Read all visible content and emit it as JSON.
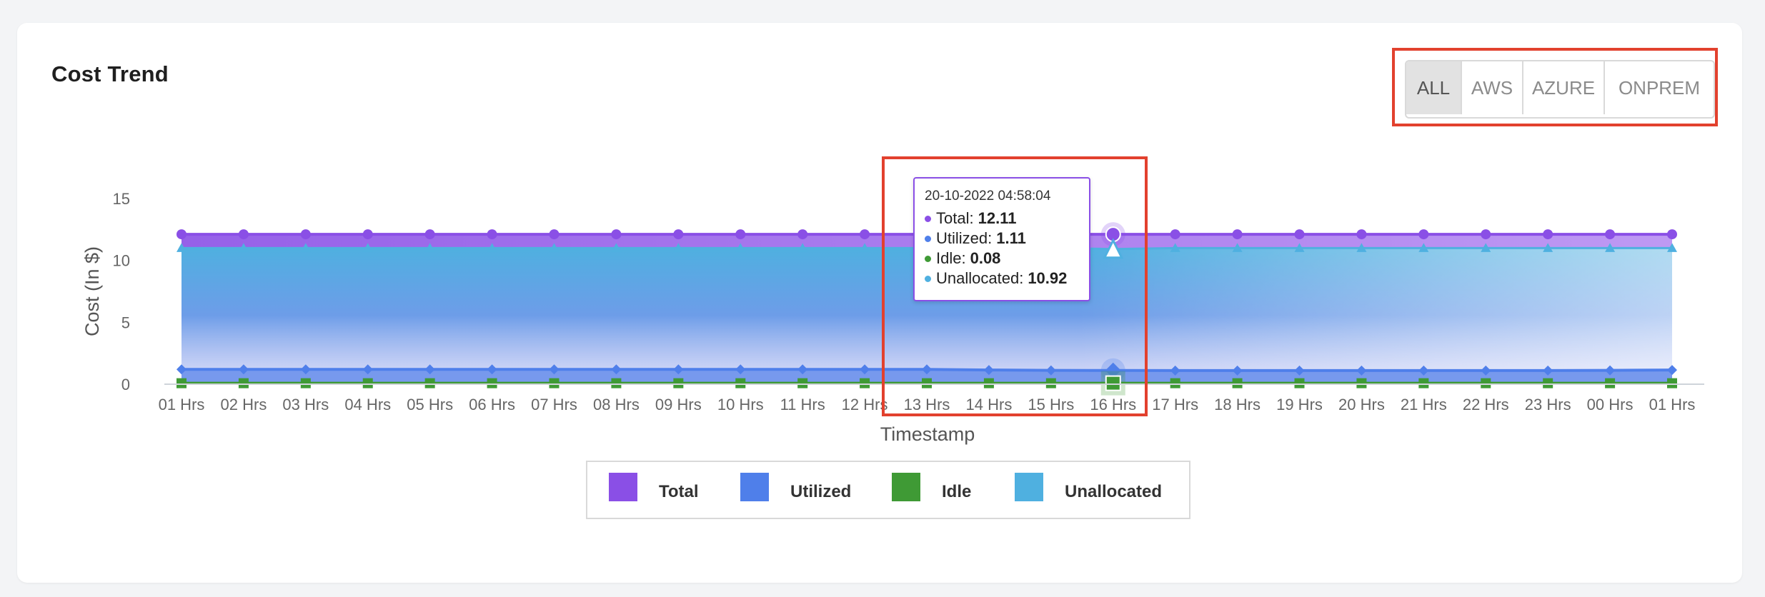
{
  "card": {
    "title": "Cost Trend"
  },
  "filters": {
    "active": "ALL",
    "items": [
      {
        "key": "all",
        "label": "ALL"
      },
      {
        "key": "aws",
        "label": "AWS"
      },
      {
        "key": "azure",
        "label": "AZURE"
      },
      {
        "key": "onprem",
        "label": "ONPREM"
      }
    ]
  },
  "tooltip": {
    "date": "20-10-2022 04:58:04",
    "rows": [
      {
        "label": "Total:",
        "value": "12.11",
        "color": "#8a4fe6"
      },
      {
        "label": "Utilized:",
        "value": "1.11",
        "color": "#4f7fea"
      },
      {
        "label": "Idle:",
        "value": "0.08",
        "color": "#3f9a35"
      },
      {
        "label": "Unallocated:",
        "value": "10.92",
        "color": "#4fb0e0"
      }
    ]
  },
  "legend": {
    "items": [
      {
        "label": "Total",
        "color": "#8a4fe6"
      },
      {
        "label": "Utilized",
        "color": "#4f7fea"
      },
      {
        "label": "Idle",
        "color": "#3f9a35"
      },
      {
        "label": "Unallocated",
        "color": "#4fb0e0"
      }
    ]
  },
  "chart_data": {
    "type": "area",
    "title": "",
    "xlabel": "Timestamp",
    "ylabel": "Cost (In $)",
    "ylim": [
      0,
      15
    ],
    "yticks": [
      0,
      5,
      10,
      15
    ],
    "categories": [
      "01 Hrs",
      "02 Hrs",
      "03 Hrs",
      "04 Hrs",
      "05 Hrs",
      "06 Hrs",
      "07 Hrs",
      "08 Hrs",
      "09 Hrs",
      "10 Hrs",
      "11 Hrs",
      "12 Hrs",
      "13 Hrs",
      "14 Hrs",
      "15 Hrs",
      "16 Hrs",
      "17 Hrs",
      "18 Hrs",
      "19 Hrs",
      "20 Hrs",
      "21 Hrs",
      "22 Hrs",
      "23 Hrs",
      "00 Hrs",
      "01 Hrs"
    ],
    "highlight_index": 15,
    "series": [
      {
        "name": "Total",
        "color": "#8a4fe6",
        "marker": "circle",
        "values": [
          12.11,
          12.11,
          12.11,
          12.11,
          12.11,
          12.11,
          12.11,
          12.11,
          12.11,
          12.11,
          12.11,
          12.11,
          12.11,
          12.11,
          12.11,
          12.11,
          12.11,
          12.11,
          12.11,
          12.11,
          12.11,
          12.11,
          12.11,
          12.11,
          12.11
        ]
      },
      {
        "name": "Utilized",
        "color": "#4f7fea",
        "marker": "diamond",
        "values": [
          1.2,
          1.2,
          1.2,
          1.2,
          1.2,
          1.2,
          1.2,
          1.2,
          1.2,
          1.2,
          1.2,
          1.2,
          1.2,
          1.15,
          1.12,
          1.11,
          1.1,
          1.1,
          1.1,
          1.1,
          1.1,
          1.1,
          1.1,
          1.12,
          1.15
        ]
      },
      {
        "name": "Idle",
        "color": "#3f9a35",
        "marker": "square",
        "values": [
          0.08,
          0.08,
          0.08,
          0.08,
          0.08,
          0.08,
          0.08,
          0.08,
          0.08,
          0.08,
          0.08,
          0.08,
          0.08,
          0.08,
          0.08,
          0.08,
          0.08,
          0.08,
          0.08,
          0.08,
          0.08,
          0.08,
          0.08,
          0.08,
          0.08
        ]
      },
      {
        "name": "Unallocated",
        "color": "#4fb0e0",
        "marker": "triangle",
        "values": [
          11.0,
          11.0,
          11.0,
          11.0,
          11.0,
          11.0,
          11.0,
          11.0,
          11.0,
          11.0,
          11.0,
          11.0,
          11.0,
          11.0,
          11.0,
          10.92,
          11.0,
          11.0,
          11.0,
          11.0,
          11.0,
          11.0,
          11.0,
          11.0,
          11.0
        ]
      }
    ]
  }
}
